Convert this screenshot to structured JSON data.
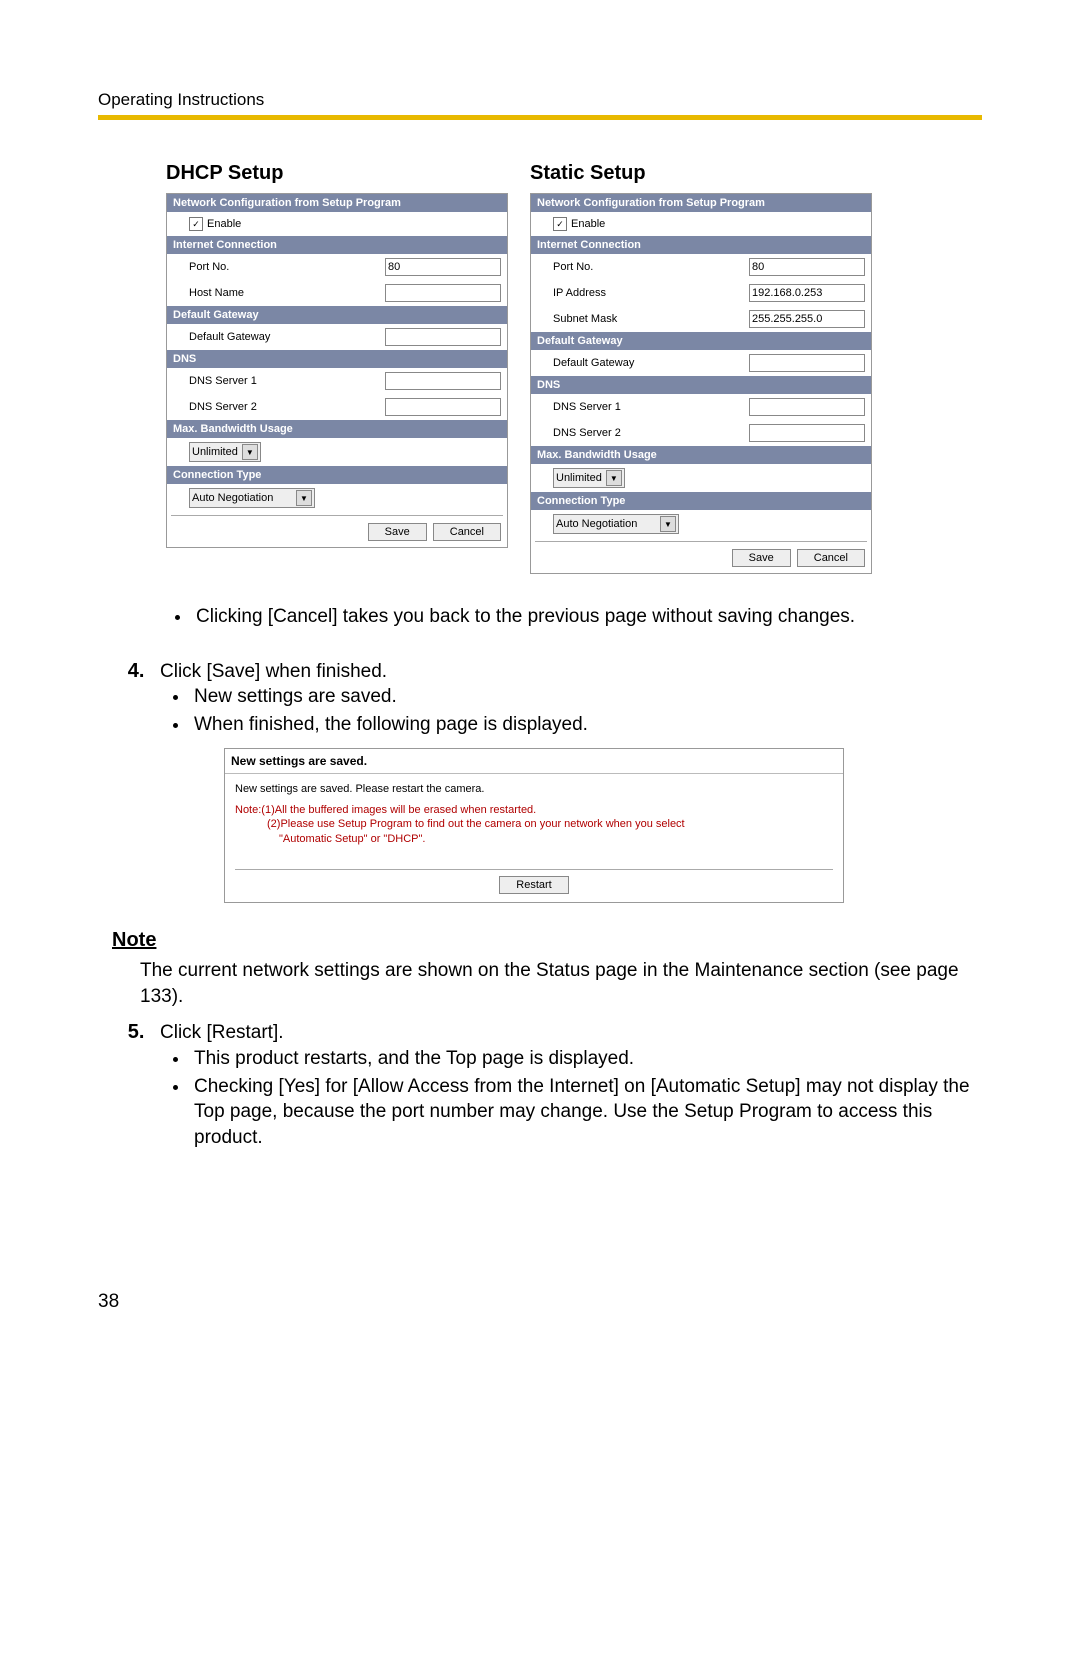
{
  "header": "Operating Instructions",
  "dhcp": {
    "title": "DHCP Setup",
    "sec1": "Network Configuration from Setup Program",
    "enable": "Enable",
    "sec2": "Internet Connection",
    "portLabel": "Port No.",
    "portValue": "80",
    "hostLabel": "Host Name",
    "hostValue": "",
    "sec3": "Default Gateway",
    "gwLabel": "Default Gateway",
    "gwValue": "",
    "sec4": "DNS",
    "dns1Label": "DNS Server 1",
    "dns1Value": "",
    "dns2Label": "DNS Server 2",
    "dns2Value": "",
    "sec5": "Max. Bandwidth Usage",
    "bw": "Unlimited",
    "sec6": "Connection Type",
    "ct": "Auto Negotiation",
    "save": "Save",
    "cancel": "Cancel"
  },
  "static": {
    "title": "Static Setup",
    "sec1": "Network Configuration from Setup Program",
    "enable": "Enable",
    "sec2": "Internet Connection",
    "portLabel": "Port No.",
    "portValue": "80",
    "ipLabel": "IP Address",
    "ipValue": "192.168.0.253",
    "maskLabel": "Subnet Mask",
    "maskValue": "255.255.255.0",
    "sec3": "Default Gateway",
    "gwLabel": "Default Gateway",
    "gwValue": "",
    "sec4": "DNS",
    "dns1Label": "DNS Server 1",
    "dns1Value": "",
    "dns2Label": "DNS Server 2",
    "dns2Value": "",
    "sec5": "Max. Bandwidth Usage",
    "bw": "Unlimited",
    "sec6": "Connection Type",
    "ct": "Auto Negotiation",
    "save": "Save",
    "cancel": "Cancel"
  },
  "bullet1": "Clicking [Cancel] takes you back to the previous page without saving changes.",
  "step4": "Click [Save] when finished.",
  "step4b1": "New settings are saved.",
  "step4b2": "When finished, the following page is displayed.",
  "saved": {
    "head": "New settings are saved.",
    "line1": "New settings are saved. Please restart the camera.",
    "note1": "Note:(1)All the buffered images will be erased when restarted.",
    "note2a": "(2)Please use Setup Program to find out the camera on your network when you select",
    "note2b": "\"Automatic Setup\" or \"DHCP\".",
    "restart": "Restart"
  },
  "noteLabel": "Note",
  "noteText": "The current network settings are shown on the Status page in the Maintenance section (see page 133).",
  "step5": "Click [Restart].",
  "step5b1": "This product restarts, and the Top page is displayed.",
  "step5b2": "Checking [Yes] for [Allow Access from the Internet] on [Automatic Setup] may not display the Top page, because the port number may change. Use the Setup Program to access this product.",
  "pageNumber": "38"
}
